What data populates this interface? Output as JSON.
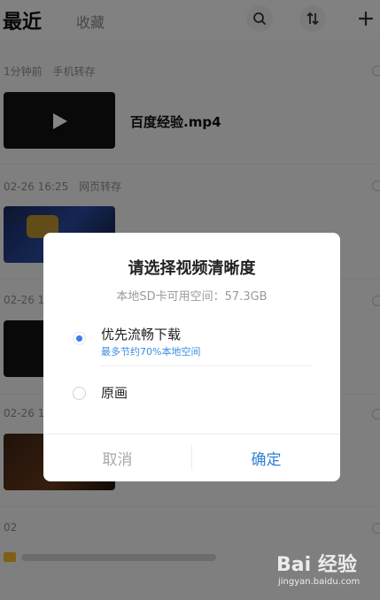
{
  "topbar": {
    "tab_recent": "最近",
    "tab_favorites": "收藏",
    "icons": {
      "search": "search-icon",
      "sort": "sort-icon",
      "add": "plus-icon"
    }
  },
  "list": {
    "groups": [
      {
        "time": "1分钟前",
        "source": "手机转存",
        "file_name": "百度经验.mp4"
      },
      {
        "time": "02-26 16:25",
        "source": "网页转存",
        "file_name": ""
      },
      {
        "time": "02-26 1",
        "source": "",
        "file_name": ""
      },
      {
        "time": "02-26 1",
        "source": "",
        "file_name": ""
      },
      {
        "time": "02",
        "source": "",
        "file_name": ""
      }
    ]
  },
  "dialog": {
    "title": "请选择视频清晰度",
    "space_info": "本地SD卡可用空间：57.3GB",
    "options": [
      {
        "label": "优先流畅下载",
        "sublabel": "最多节约70%本地空间",
        "selected": true
      },
      {
        "label": "原画",
        "sublabel": "",
        "selected": false
      }
    ],
    "cancel_label": "取消",
    "confirm_label": "确定"
  },
  "watermark": {
    "main": "Bai 经验",
    "sub": "jingyan.baidu.com"
  },
  "colors": {
    "accent": "#3a7de8",
    "confirm": "#2f7fd4",
    "subtext_blue": "#3a8de0"
  }
}
